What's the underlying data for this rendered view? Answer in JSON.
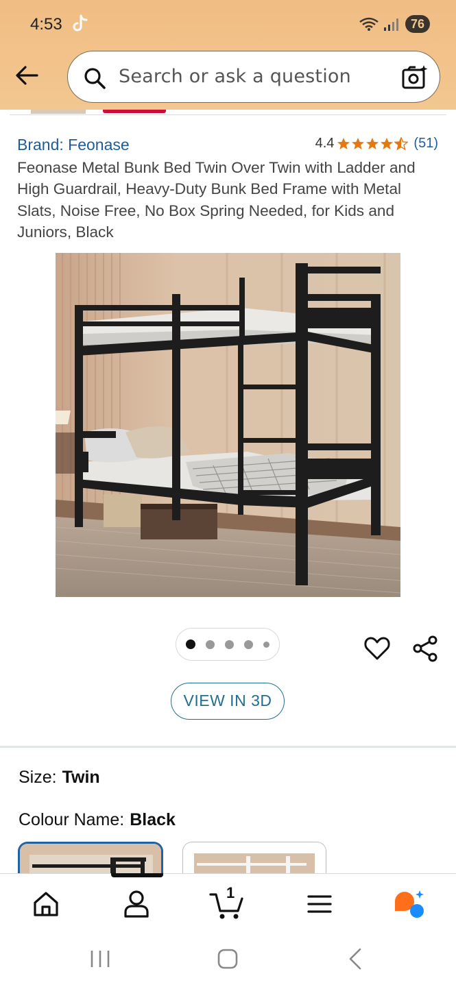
{
  "status_bar": {
    "time": "4:53",
    "battery": "76"
  },
  "search": {
    "placeholder": "Search or ask a question"
  },
  "product": {
    "brand": "Brand: Feonase",
    "rating": "4.4",
    "stars": 4.4,
    "rating_count": "(51)",
    "title": "Feonase Metal Bunk Bed Twin Over Twin with Ladder and High Guardrail, Heavy-Duty Bunk Bed Frame with Metal Slats, Noise Free, No Box Spring Needed, for Kids and Juniors, Black",
    "image_count": 5,
    "active_image": 1
  },
  "actions": {
    "view_3d": "VIEW IN 3D"
  },
  "variations": {
    "size_label": "Size:",
    "size_value": "Twin",
    "colour_label": "Colour Name:",
    "colour_value": "Black"
  },
  "bottom_nav": {
    "cart_count": "1",
    "items": [
      "home",
      "account",
      "cart",
      "menu",
      "rufus"
    ]
  },
  "colors": {
    "header_bg": "#f3c790",
    "link": "#1f5c9a",
    "star": "#e47911",
    "selected_border": "#2162a1"
  }
}
